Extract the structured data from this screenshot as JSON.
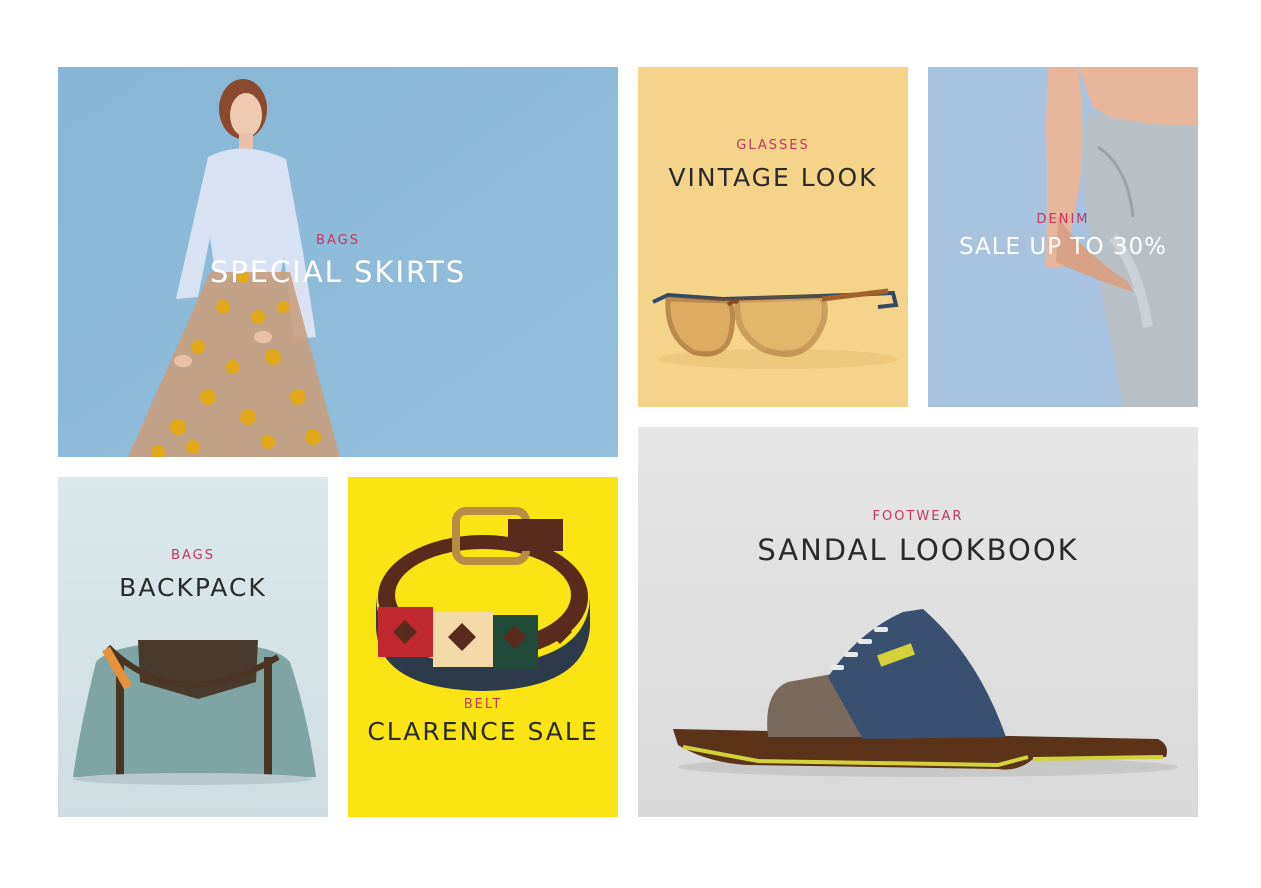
{
  "tiles": {
    "skirts": {
      "category": "BAGS",
      "title": "SPECIAL SKIRTS",
      "bg": "#8dbbd9"
    },
    "glasses": {
      "category": "GLASSES",
      "title": "VINTAGE LOOK",
      "bg": "#f6d38a"
    },
    "denim": {
      "category": "DENIM",
      "title": "SALE UP TO 30%",
      "bg": "#a7c3df"
    },
    "backpack": {
      "category": "BAGS",
      "title": "BACKPACK",
      "bg": "#d6e4e8"
    },
    "belt": {
      "category": "BELT",
      "title": "CLARENCE SALE",
      "bg": "#fbe414"
    },
    "sandal": {
      "category": "FOOTWEAR",
      "title": "SANDAL LOOKBOOK",
      "bg": "#e5e5e5"
    }
  },
  "colors": {
    "accent": "#c2365e",
    "title_dark": "#2b2b2b",
    "title_light": "#ffffff"
  }
}
